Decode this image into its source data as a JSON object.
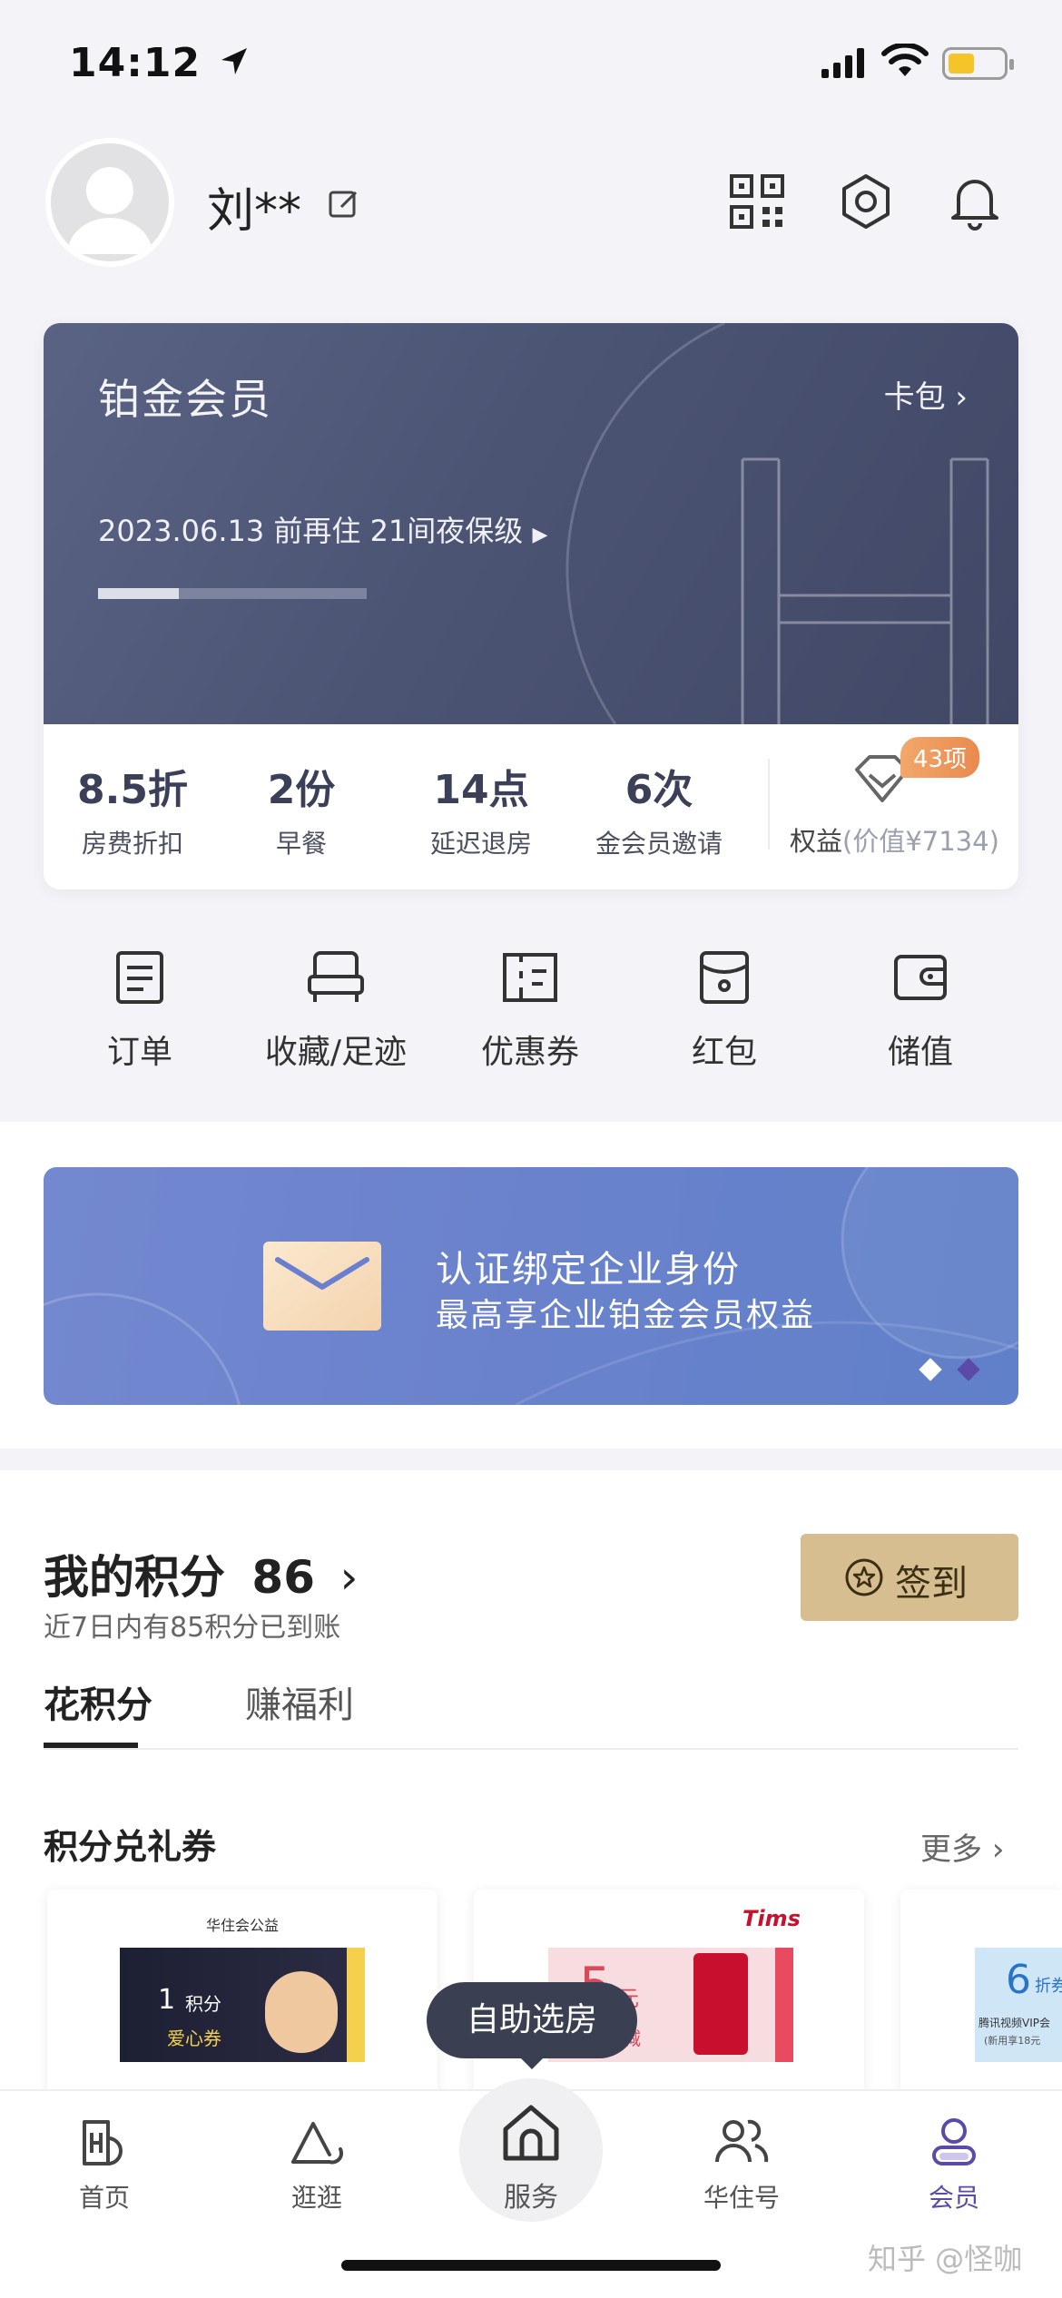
{
  "status_bar": {
    "time": "14:12"
  },
  "header": {
    "username": "刘**"
  },
  "member_card": {
    "tier": "铂金会员",
    "wallet_label": "卡包",
    "progress_text": "2023.06.13 前再住 21间夜保级",
    "progress_fraction": 0.3,
    "stats": [
      {
        "value": "8.5折",
        "label": "房费折扣"
      },
      {
        "value": "2份",
        "label": "早餐"
      },
      {
        "value": "14点",
        "label": "延迟退房"
      },
      {
        "value": "6次",
        "label": "金会员邀请"
      }
    ],
    "benefits_badge": "43项",
    "benefits_label": "权益",
    "benefits_value": "(价值¥7134)"
  },
  "quick_links": [
    {
      "label": "订单",
      "icon": "order-icon"
    },
    {
      "label": "收藏/足迹",
      "icon": "bed-icon"
    },
    {
      "label": "优惠券",
      "icon": "coupon-icon"
    },
    {
      "label": "红包",
      "icon": "red-packet-icon"
    },
    {
      "label": "储值",
      "icon": "wallet-icon"
    }
  ],
  "banner": {
    "line1": "认证绑定企业身份",
    "line2": "最高享企业铂金会员权益",
    "dots": 2,
    "active_dot": 1
  },
  "points": {
    "title": "我的积分",
    "value": "86",
    "subtitle": "近7日内有85积分已到账",
    "checkin_label": "签到"
  },
  "tabs": [
    {
      "label": "花积分",
      "active": true
    },
    {
      "label": "赚福利",
      "active": false
    }
  ],
  "section": {
    "title": "积分兑礼券",
    "more": "更多"
  },
  "coupons": [
    {
      "brand": "华住会公益",
      "amount": "1",
      "unit": "积分",
      "name": "爱心券"
    },
    {
      "brand": "Tims",
      "amount": "5",
      "note": "元",
      "desc": "减"
    },
    {
      "amount": "6",
      "unit": "折券",
      "desc": "腾讯视频VIP会",
      "desc2": "(新用享18元"
    }
  ],
  "floating_bubble": "自助选房",
  "tabbar": [
    {
      "label": "首页",
      "icon": "hotel-icon"
    },
    {
      "label": "逛逛",
      "icon": "explore-icon"
    },
    {
      "label": "服务",
      "icon": "home-service-icon"
    },
    {
      "label": "华住号",
      "icon": "people-icon"
    },
    {
      "label": "会员",
      "icon": "member-icon"
    }
  ],
  "watermark": "知乎 @怪咖",
  "colors": {
    "accent": "#5b4aa8",
    "card_dark": "#4c5474",
    "banner_blue": "#6a82cc",
    "checkin_gold": "#d6be90"
  }
}
